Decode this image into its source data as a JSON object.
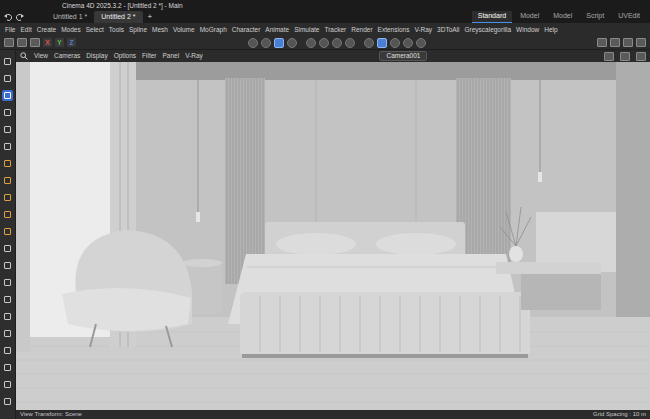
{
  "window": {
    "title": "Cinema 4D 2025.3.2 - [Untitled 2 *] - Main"
  },
  "doc_tabs": [
    {
      "label": "Untitled 1 *",
      "selected": false
    },
    {
      "label": "Untitled 2 *",
      "selected": true
    }
  ],
  "new_tab": "+",
  "layouts": [
    {
      "label": "Standard",
      "selected": true
    },
    {
      "label": "Model",
      "selected": false
    },
    {
      "label": "Model",
      "selected": false
    },
    {
      "label": "Script",
      "selected": false
    },
    {
      "label": "UVEdit",
      "selected": false
    }
  ],
  "menu": [
    "File",
    "Edit",
    "Create",
    "Modes",
    "Select",
    "Tools",
    "Spline",
    "Mesh",
    "Volume",
    "MoGraph",
    "Character",
    "Animate",
    "Simulate",
    "Tracker",
    "Render",
    "Extensions",
    "V-Ray",
    "3DToAll",
    "Greyscalegorilla",
    "Window",
    "Help"
  ],
  "axes": [
    {
      "label": "X",
      "color": "#e05050"
    },
    {
      "label": "Y",
      "color": "#5cb84c"
    },
    {
      "label": "Z",
      "color": "#4f80dc"
    }
  ],
  "toolbar": [
    {
      "selected": false
    },
    {
      "selected": false
    },
    {
      "selected": true
    },
    {
      "selected": false
    },
    {
      "selected": false
    },
    {
      "selected": false
    },
    {
      "selected": false
    },
    {
      "selected": false
    },
    {
      "selected": false
    },
    {
      "selected": true
    },
    {
      "selected": false
    },
    {
      "selected": false
    },
    {
      "selected": false
    }
  ],
  "left_tools": [
    {
      "selected": false,
      "color": "#c8c8c8"
    },
    {
      "selected": false,
      "color": "#c8c8c8"
    },
    {
      "selected": true,
      "color": "#ffffff"
    },
    {
      "selected": false,
      "color": "#c8c8c8"
    },
    {
      "selected": false,
      "color": "#c8c8c8"
    },
    {
      "selected": false,
      "color": "#c8c8c8"
    },
    {
      "selected": false,
      "color": "#e0a040"
    },
    {
      "selected": false,
      "color": "#e0a040"
    },
    {
      "selected": false,
      "color": "#e0a040"
    },
    {
      "selected": false,
      "color": "#e0a040"
    },
    {
      "selected": false,
      "color": "#e0a040"
    },
    {
      "selected": false,
      "color": "#c8c8c8"
    },
    {
      "selected": false,
      "color": "#c8c8c8"
    },
    {
      "selected": false,
      "color": "#c8c8c8"
    },
    {
      "selected": false,
      "color": "#c8c8c8"
    },
    {
      "selected": false,
      "color": "#c8c8c8"
    },
    {
      "selected": false,
      "color": "#c8c8c8"
    },
    {
      "selected": false,
      "color": "#c8c8c8"
    },
    {
      "selected": false,
      "color": "#c8c8c8"
    },
    {
      "selected": false,
      "color": "#c8c8c8"
    },
    {
      "selected": false,
      "color": "#c8c8c8"
    }
  ],
  "viewport": {
    "menu": [
      "View",
      "Cameras",
      "Display",
      "Options",
      "Filter",
      "Panel",
      "V-Ray"
    ],
    "camera": "Camera001"
  },
  "status_bar": {
    "left": "View Transform: Scene",
    "right": "Grid Spacing : 10 m"
  }
}
